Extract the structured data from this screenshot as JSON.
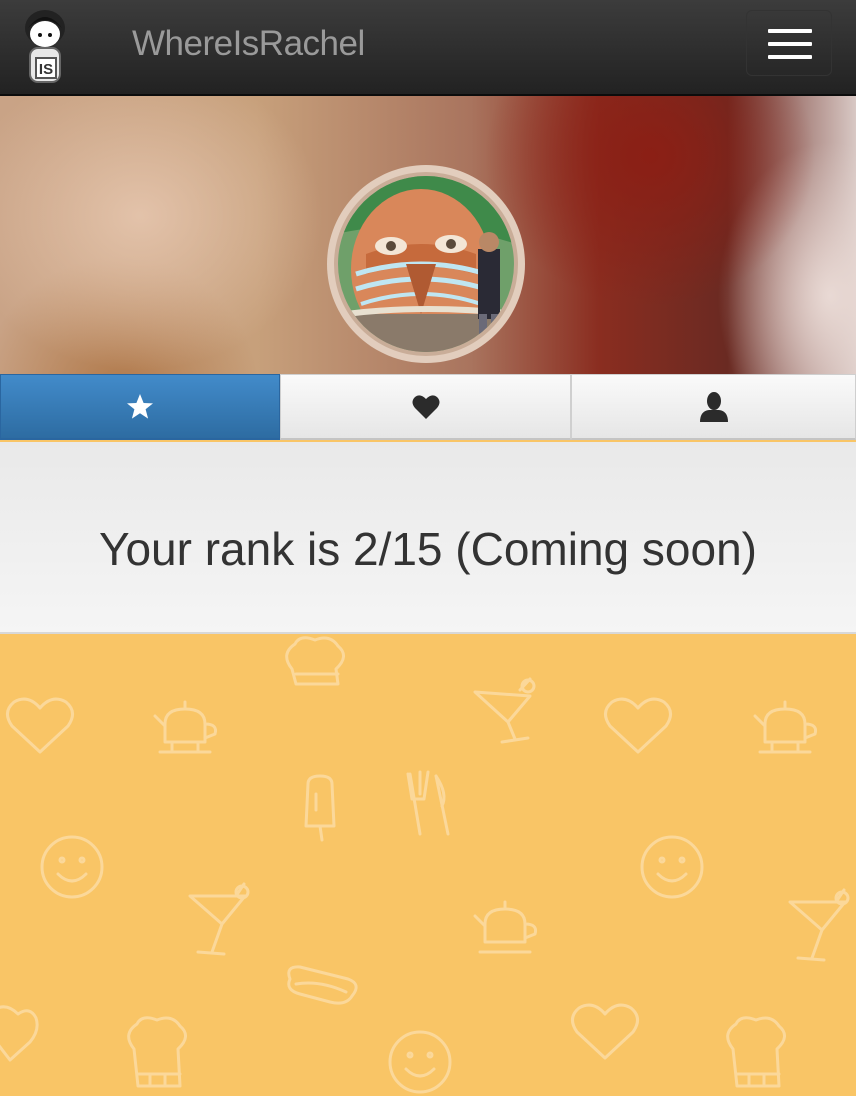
{
  "navbar": {
    "brand": "WhereIsRachel",
    "logo_icon": "rachel-mascot-icon",
    "menu_icon": "hamburger-menu-icon"
  },
  "profile": {
    "cover": "blurred-cover-photo",
    "avatar": "profile-avatar-photo"
  },
  "tabs": [
    {
      "icon": "star-icon",
      "active": true
    },
    {
      "icon": "heart-icon",
      "active": false
    },
    {
      "icon": "user-icon",
      "active": false
    }
  ],
  "rank": {
    "text": "Your rank is 2/15 (Coming soon)"
  },
  "colors": {
    "navbar": "#2b2b2b",
    "active_tab": "#3a7fc0",
    "background": "#f9c566",
    "pattern_line": "#fbd89a"
  }
}
